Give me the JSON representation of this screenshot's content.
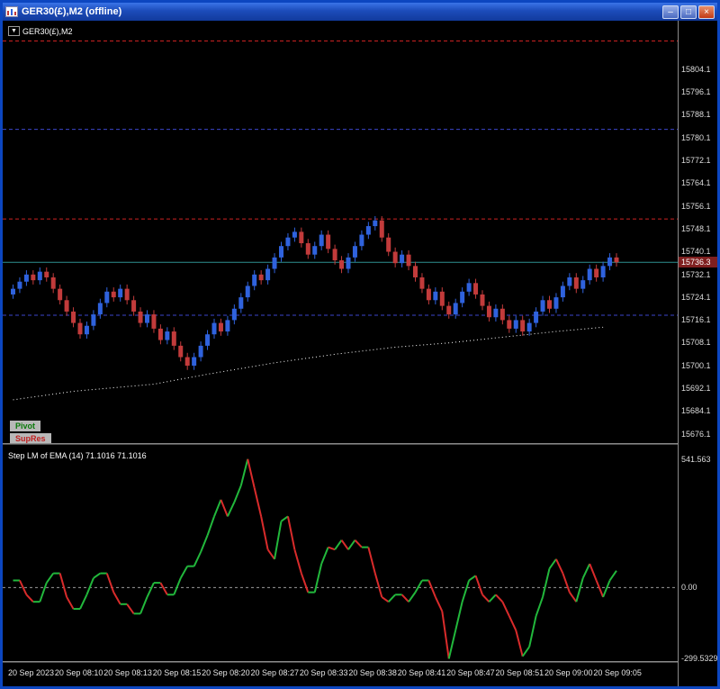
{
  "window": {
    "title": "GER30(£),M2 (offline)",
    "controls": {
      "minimize": "–",
      "restore": "□",
      "close": "×"
    }
  },
  "chart": {
    "symbol_label": "GER30(£),M2",
    "dropdown_arrow": "▼",
    "legend": [
      {
        "label": "Pivot",
        "color": "#0a7a0a",
        "background": "#b8b8b8"
      },
      {
        "label": "SupRes",
        "color": "#c02020",
        "background": "#b8b8b8"
      }
    ],
    "price_axis": {
      "ticks": [
        "15804.1",
        "15796.1",
        "15788.1",
        "15780.1",
        "15772.1",
        "15764.1",
        "15756.1",
        "15748.1",
        "15740.1",
        "15732.1",
        "15724.1",
        "15716.1",
        "15708.1",
        "15700.1",
        "15692.1",
        "15684.1",
        "15676.1"
      ],
      "current": "15736.3",
      "badge_background": "#7f1f1f"
    }
  },
  "indicator": {
    "label": "Step LM of EMA (14) 71.1016 71.1016"
  },
  "time_axis": {
    "labels": [
      "20 Sep 2023",
      "20 Sep 08:10",
      "20 Sep 08:13",
      "20 Sep 08:15",
      "20 Sep 08:20",
      "20 Sep 08:27",
      "20 Sep 08:33",
      "20 Sep 08:38",
      "20 Sep 08:41",
      "20 Sep 08:47",
      "20 Sep 08:51",
      "20 Sep 09:00",
      "20 Sep 09:05"
    ]
  },
  "chart_data": [
    {
      "type": "candlestick",
      "title": "GER30(£),M2",
      "timeframe": "M2",
      "ylim": [
        15672.8,
        15820.5
      ],
      "first_open": 15725,
      "wick_pad": 1.5,
      "up_color": "#2f62dd",
      "down_color": "#c23b3b",
      "closes": [
        15727,
        15729.5,
        15732,
        15730,
        15733,
        15731,
        15727,
        15723,
        15719,
        15715,
        15711,
        15714,
        15718,
        15722,
        15726,
        15724,
        15727,
        15723,
        15719,
        15715,
        15718,
        15713,
        15709,
        15712,
        15707,
        15703,
        15700,
        15703,
        15707,
        15711,
        15715,
        15712,
        15716,
        15720,
        15724,
        15728,
        15732,
        15730,
        15734,
        15738,
        15742,
        15745,
        15747,
        15743,
        15739,
        15742,
        15746,
        15741,
        15737,
        15734,
        15738,
        15742,
        15746,
        15749,
        15751,
        15745,
        15740,
        15736,
        15739,
        15735,
        15731,
        15727,
        15723,
        15726,
        15721,
        15718,
        15722,
        15726,
        15729,
        15725,
        15721,
        15717,
        15720,
        15716,
        15713,
        15716,
        15712,
        15715,
        15719,
        15723,
        15720,
        15724,
        15728,
        15731,
        15727,
        15730,
        15734,
        15731,
        15735,
        15738,
        15736.3
      ],
      "levels": [
        {
          "name": "resistance-upper",
          "price": 15814,
          "color": "#cc2222",
          "style": "dashed"
        },
        {
          "name": "support-upper",
          "price": 15783,
          "color": "#3c46cc",
          "style": "dashed"
        },
        {
          "name": "resistance-lower",
          "price": 15751.5,
          "color": "#cc2222",
          "style": "dashed"
        },
        {
          "name": "current-price-line",
          "price": 15736.3,
          "color": "#2e8f8f",
          "style": "solid"
        },
        {
          "name": "support-lower",
          "price": 15717.7,
          "color": "#3c46cc",
          "style": "dashed"
        }
      ],
      "ma_dotted_points": [
        [
          0,
          15688
        ],
        [
          9,
          15691
        ],
        [
          21,
          15693.5
        ],
        [
          29,
          15697
        ],
        [
          39,
          15701
        ],
        [
          48,
          15704
        ],
        [
          57,
          15706.5
        ],
        [
          65,
          15708
        ],
        [
          73,
          15710
        ],
        [
          81,
          15712
        ],
        [
          88,
          15713.5
        ]
      ],
      "ma_color": "#ffffff"
    },
    {
      "type": "line",
      "title": "Step LM of EMA (14)",
      "ylim": [
        -310,
        590
      ],
      "zero_line": true,
      "zero_line_color": "#9a9a9a",
      "up_color": "#22b83c",
      "down_color": "#d92b2b",
      "axis_labels": [
        "541.563",
        "0.00",
        "-299.5329"
      ],
      "axis_values": [
        541.563,
        0,
        -299.5329
      ],
      "values": [
        30,
        30,
        -30,
        -60,
        -60,
        20,
        60,
        60,
        -40,
        -90,
        -90,
        -30,
        40,
        60,
        60,
        -20,
        -70,
        -70,
        -110,
        -110,
        -40,
        20,
        20,
        -30,
        -30,
        40,
        90,
        90,
        150,
        220,
        300,
        370,
        300,
        360,
        430,
        541.5,
        420,
        300,
        160,
        120,
        280,
        300,
        160,
        60,
        -20,
        -20,
        100,
        170,
        160,
        200,
        160,
        200,
        170,
        170,
        60,
        -40,
        -60,
        -30,
        -30,
        -60,
        -20,
        30,
        30,
        -40,
        -100,
        -300,
        -180,
        -60,
        30,
        50,
        -30,
        -60,
        -30,
        -60,
        -120,
        -180,
        -290,
        -250,
        -120,
        -40,
        80,
        120,
        60,
        -20,
        -60,
        40,
        100,
        30,
        -40,
        30,
        71.1
      ]
    }
  ]
}
